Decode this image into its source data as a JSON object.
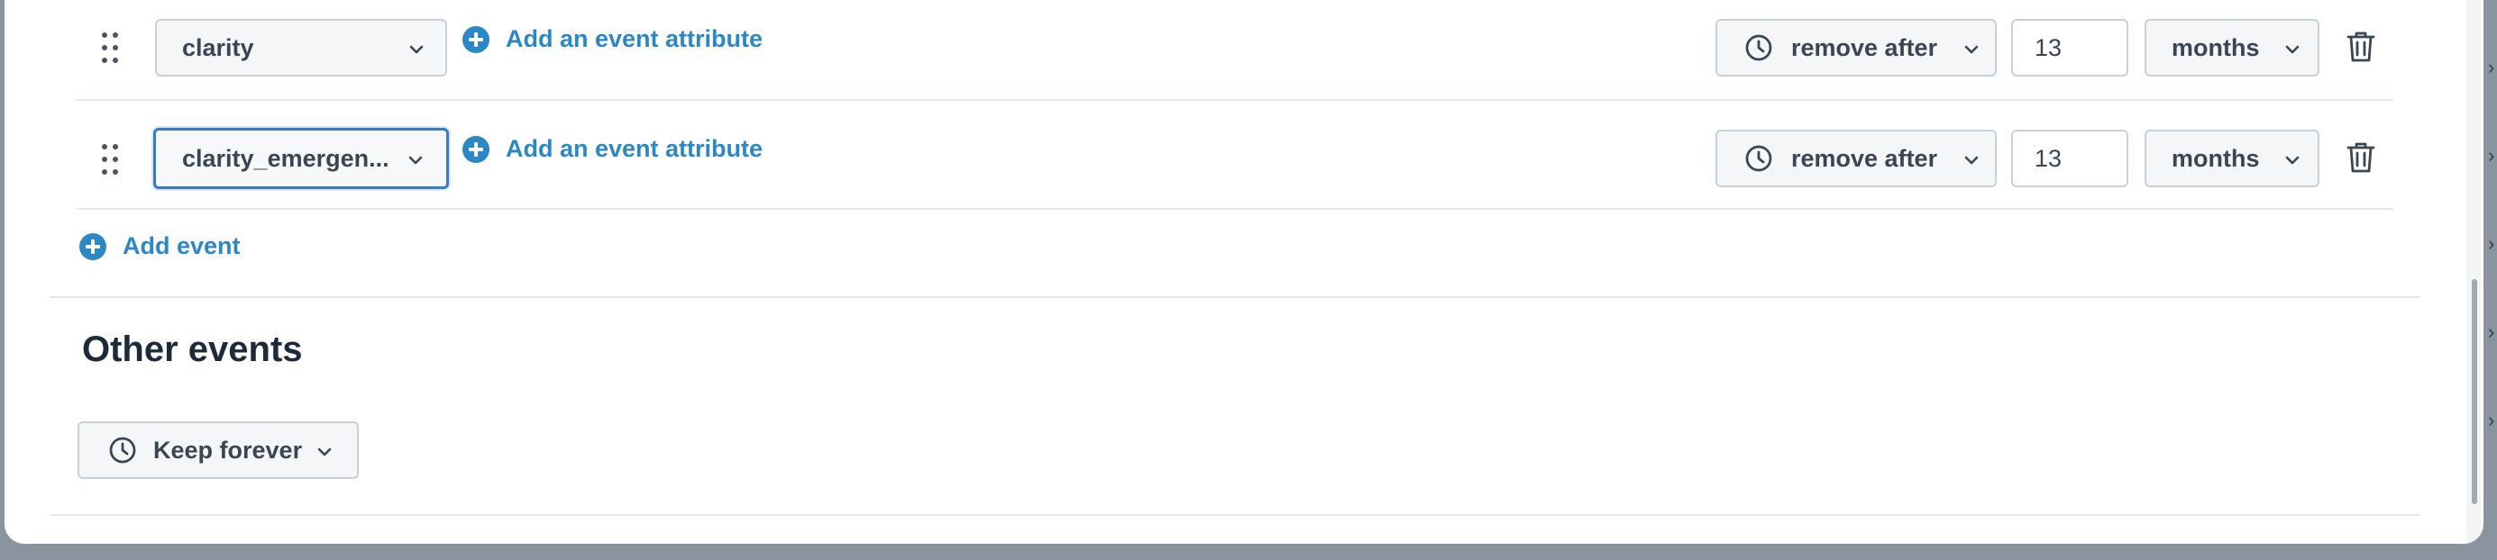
{
  "events": [
    {
      "event_value": "clarity",
      "add_attribute_label": "Add an event attribute",
      "retention_action": "remove after",
      "retention_amount": "13",
      "retention_unit": "months"
    },
    {
      "event_value": "clarity_emergen...",
      "add_attribute_label": "Add an event attribute",
      "retention_action": "remove after",
      "retention_amount": "13",
      "retention_unit": "months"
    }
  ],
  "add_event_label": "Add event",
  "other_events": {
    "heading": "Other events",
    "retention_action": "Keep forever"
  },
  "colors": {
    "accent": "#2c87c5",
    "text": "#3b4654",
    "heading": "#1c2b3a",
    "border": "#c8d0d8",
    "focus": "#3a79c4"
  },
  "icons": {
    "drag": "drag-handle-icon",
    "chevron": "chevron-down-icon",
    "plus": "plus-circle-icon",
    "clock": "clock-icon",
    "trash": "trash-icon"
  }
}
